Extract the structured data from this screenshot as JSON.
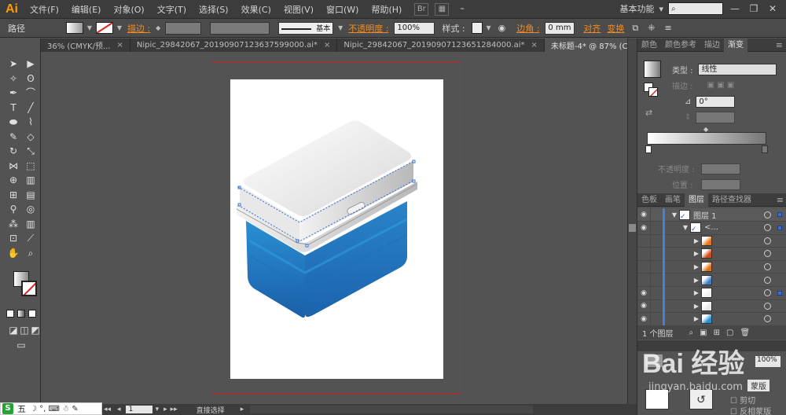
{
  "app": {
    "logo": "Ai",
    "menus": [
      "文件(F)",
      "编辑(E)",
      "对象(O)",
      "文字(T)",
      "选择(S)",
      "效果(C)",
      "视图(V)",
      "窗口(W)",
      "帮助(H)"
    ],
    "menu_btn_br": "Br",
    "workspace": "基本功能",
    "workspace_caret": "▾",
    "window_buttons": [
      "—",
      "❐",
      "✕"
    ]
  },
  "control": {
    "selection_type": "路径",
    "stroke_label": "描边 :",
    "stroke_style": "基本",
    "opacity_label": "不透明度 :",
    "opacity_value": "100%",
    "style_label": "样式 :",
    "corner_label": "边角 :",
    "corner_value": "0 mm",
    "align_label": "对齐",
    "transform_label": "变换"
  },
  "tabs": [
    {
      "label": "36% (CMYK/预...",
      "active": false
    },
    {
      "label": "Nipic_29842067_20190907123637599000.ai*",
      "active": false
    },
    {
      "label": "Nipic_29842067_20190907123651284000.ai*",
      "active": false
    },
    {
      "label": "未标题-4* @ 87% (CMYK/预览)",
      "active": true
    }
  ],
  "tab_close": "×",
  "statusbar": {
    "page": "1",
    "tool_name": "直接选择"
  },
  "panels": {
    "top_tabs": [
      "颜色",
      "颜色参考",
      "描边",
      "渐变"
    ],
    "gradient": {
      "type_label": "类型 :",
      "type_value": "线性",
      "stroke_label": "描边 :",
      "angle_value": "0°",
      "opacity_label": "不透明度 :",
      "position_label": "位置 :"
    },
    "mid_tabs": [
      "色板",
      "画笔",
      "图层",
      "路径查找器"
    ],
    "layers": [
      {
        "name": "图层 1",
        "indent": 0,
        "visible": true,
        "expanded": true,
        "selected": true
      },
      {
        "name": "<...",
        "indent": 1,
        "visible": true,
        "expanded": true,
        "selected": false
      },
      {
        "name": "",
        "indent": 2,
        "visible": false,
        "thumb": "#e9731a"
      },
      {
        "name": "",
        "indent": 2,
        "visible": false,
        "thumb": "#d14a12"
      },
      {
        "name": "",
        "indent": 2,
        "visible": false,
        "thumb": "#e07216"
      },
      {
        "name": "",
        "indent": 2,
        "visible": false,
        "thumb": "#3b7fc4"
      },
      {
        "name": "",
        "indent": 2,
        "visible": true,
        "thumb": "#f0f0f0"
      },
      {
        "name": "",
        "indent": 2,
        "visible": true,
        "thumb": "#e6e6e6"
      },
      {
        "name": "",
        "indent": 2,
        "visible": true,
        "thumb": "#2a8fd0"
      }
    ],
    "layers_count": "1 个图层",
    "bottom_label_blend": "混合",
    "bottom_opacity": "100%",
    "bottom_clip": "剪切",
    "bottom_invert": "反相蒙版",
    "bottom_clip2": "蒙版"
  },
  "watermark": {
    "text": "Bai 经验",
    "sub": "jingyan.baidu.com"
  },
  "ime": {
    "badge": "S",
    "label": "五",
    "icons": "☽ °, ⌨ ☃ ✎"
  },
  "colors": {
    "accent_orange": "#f08a24",
    "artboard_border": "#d42020",
    "cooler_blue_top": "#2b8fd3",
    "cooler_blue_bottom": "#1a5fa8"
  }
}
